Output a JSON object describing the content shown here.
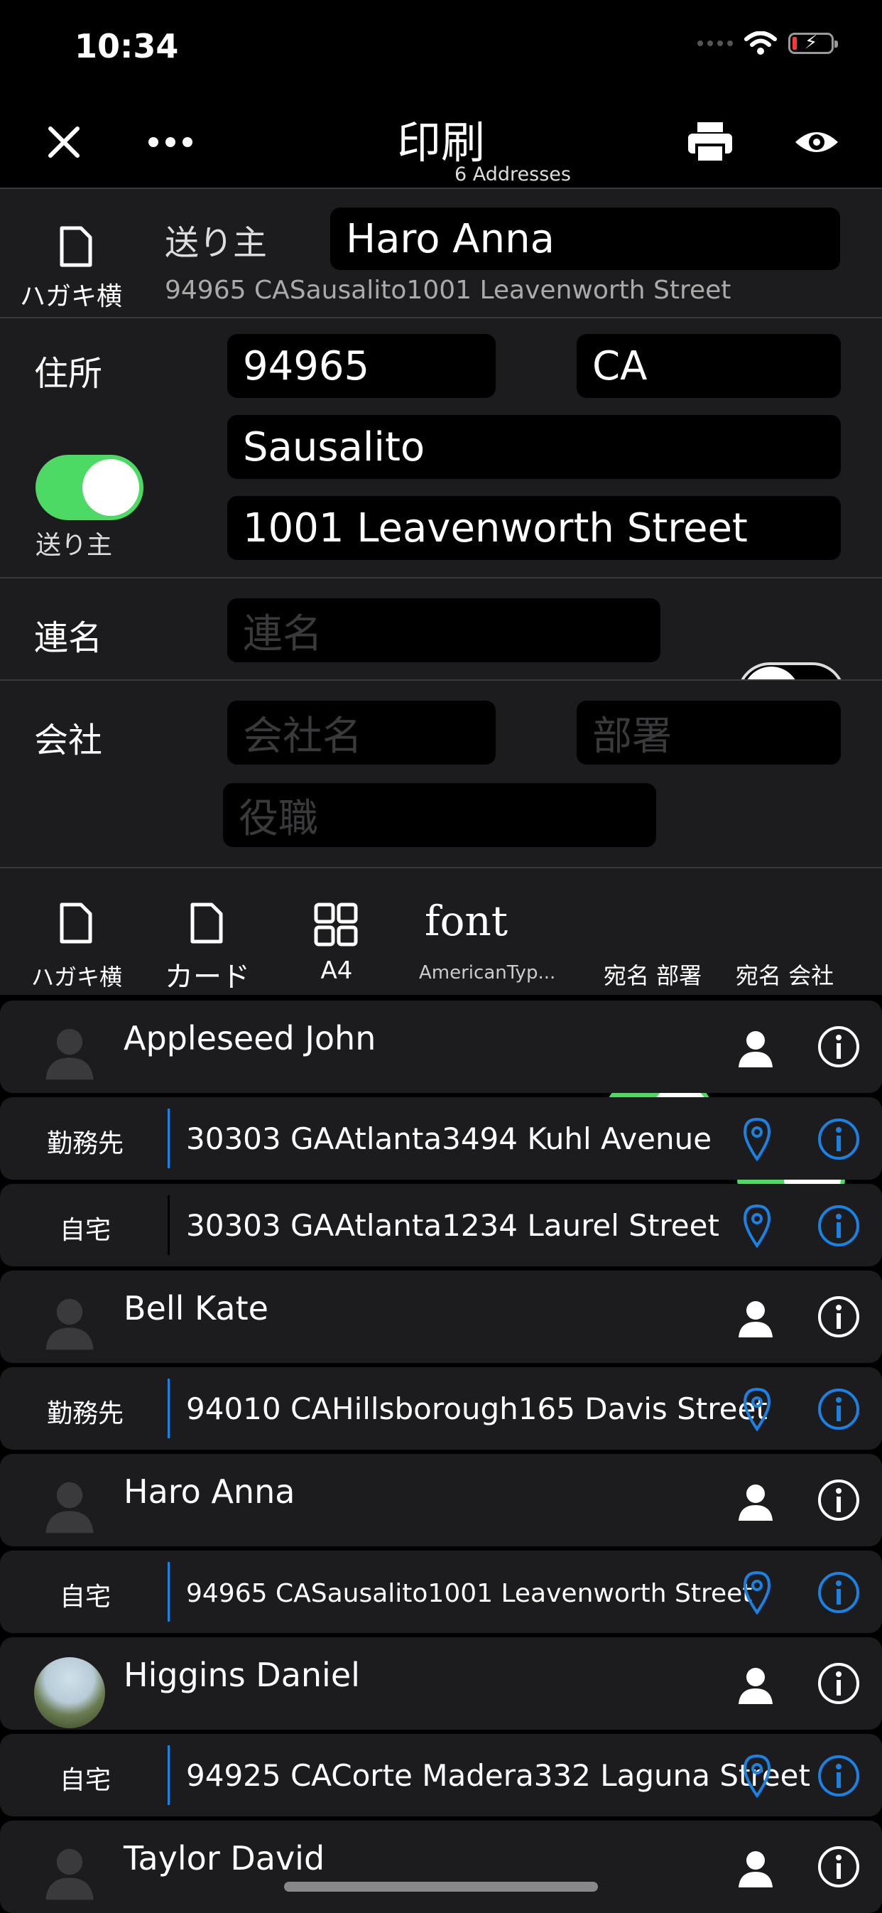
{
  "status": {
    "time": "10:34"
  },
  "nav": {
    "title": "印刷",
    "subtitle": "6 Addresses"
  },
  "sender": {
    "icon_label": "ハガキ横",
    "label": "送り主",
    "name_value": "Haro Anna",
    "address_summary": "94965 CASausalito1001  Leavenworth Street"
  },
  "address": {
    "label": "住所",
    "zip": "94965",
    "state": "CA",
    "city": "Sausalito",
    "street": "1001  Leavenworth Street",
    "toggle_label": "送り主",
    "toggle_on": true
  },
  "joint": {
    "label": "連名",
    "placeholder": "連名",
    "toggle_on": false
  },
  "company": {
    "label": "会社",
    "name_placeholder": "会社名",
    "dept_placeholder": "部署",
    "title_placeholder": "役職",
    "toggle_on": false
  },
  "toolbar": {
    "postcard_label": "ハガキ横",
    "card_label": "カード",
    "a4_label": "A4",
    "font_label": "font",
    "font_name": "AmericanTyp...",
    "dept_toggle_label": "宛名 部署",
    "company_toggle_label": "宛名 会社"
  },
  "contacts": [
    {
      "name": "Appleseed John",
      "addresses": [
        {
          "type": "勤務先",
          "text": "30303 GAAtlanta3494 Kuhl Avenue"
        },
        {
          "type": "自宅",
          "text": "30303 GAAtlanta1234 Laurel Street"
        }
      ]
    },
    {
      "name": "Bell Kate",
      "addresses": [
        {
          "type": "勤務先",
          "text": "94010 CAHillsborough165 Davis Street"
        }
      ]
    },
    {
      "name": "Haro Anna",
      "addresses": [
        {
          "type": "自宅",
          "text": "94965 CASausalito1001  Leavenworth Street"
        }
      ]
    },
    {
      "name": "Higgins Daniel",
      "addresses": [
        {
          "type": "自宅",
          "text": "94925 CACorte Madera332 Laguna Street"
        }
      ]
    },
    {
      "name": "Taylor David",
      "addresses": []
    }
  ],
  "colors": {
    "accent_green": "#4cd964",
    "link_blue": "#1a82e2",
    "background": "#000000",
    "row_bg": "#1c1c1e"
  }
}
